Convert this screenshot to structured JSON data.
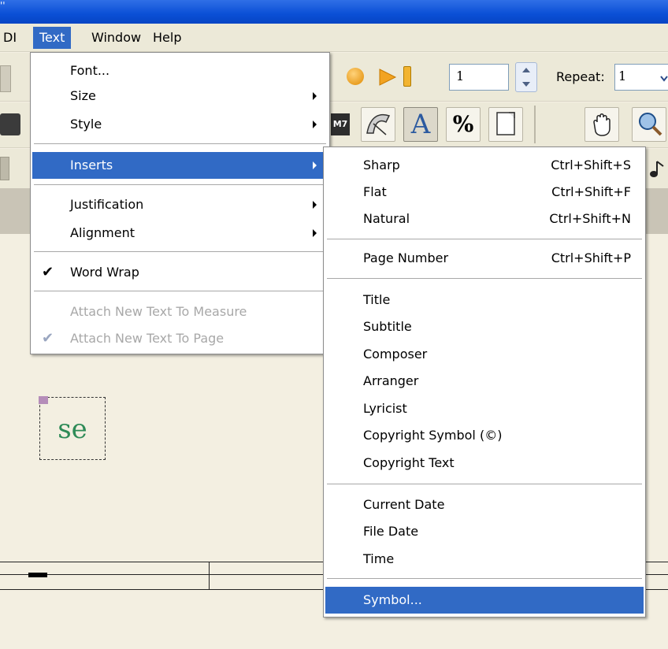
{
  "title_fragment": "''",
  "menubar": {
    "items": [
      {
        "label": "DI"
      },
      {
        "label": "Text"
      },
      {
        "label": "Window"
      },
      {
        "label": "Help"
      }
    ]
  },
  "toolbar": {
    "page_value": "1",
    "repeat_label": "Repeat:",
    "repeat_value": "1",
    "chord_label": "M7",
    "text_tool_label": "A",
    "percent_label": "%"
  },
  "canvas": {
    "text_sample": "se"
  },
  "text_menu": {
    "items": [
      {
        "label": "Font..."
      },
      {
        "label": "Size"
      },
      {
        "label": "Style"
      },
      {
        "label": "Inserts"
      },
      {
        "label": "Justification"
      },
      {
        "label": "Alignment"
      },
      {
        "label": "Word Wrap"
      },
      {
        "label": "Attach New Text To Measure"
      },
      {
        "label": "Attach New Text To Page"
      }
    ]
  },
  "inserts_menu": {
    "items": [
      {
        "label": "Sharp",
        "shortcut": "Ctrl+Shift+S"
      },
      {
        "label": "Flat",
        "shortcut": "Ctrl+Shift+F"
      },
      {
        "label": "Natural",
        "shortcut": "Ctrl+Shift+N"
      },
      {
        "label": "Page Number",
        "shortcut": "Ctrl+Shift+P"
      },
      {
        "label": "Title"
      },
      {
        "label": "Subtitle"
      },
      {
        "label": "Composer"
      },
      {
        "label": "Arranger"
      },
      {
        "label": "Lyricist"
      },
      {
        "label": "Copyright Symbol (©)"
      },
      {
        "label": "Copyright Text"
      },
      {
        "label": "Current Date"
      },
      {
        "label": "File Date"
      },
      {
        "label": "Time"
      },
      {
        "label": "Symbol..."
      }
    ]
  },
  "colors": {
    "highlight": "#316ac5",
    "titlebar": "#0a4fd6",
    "menu_face": "#ece9d8"
  }
}
